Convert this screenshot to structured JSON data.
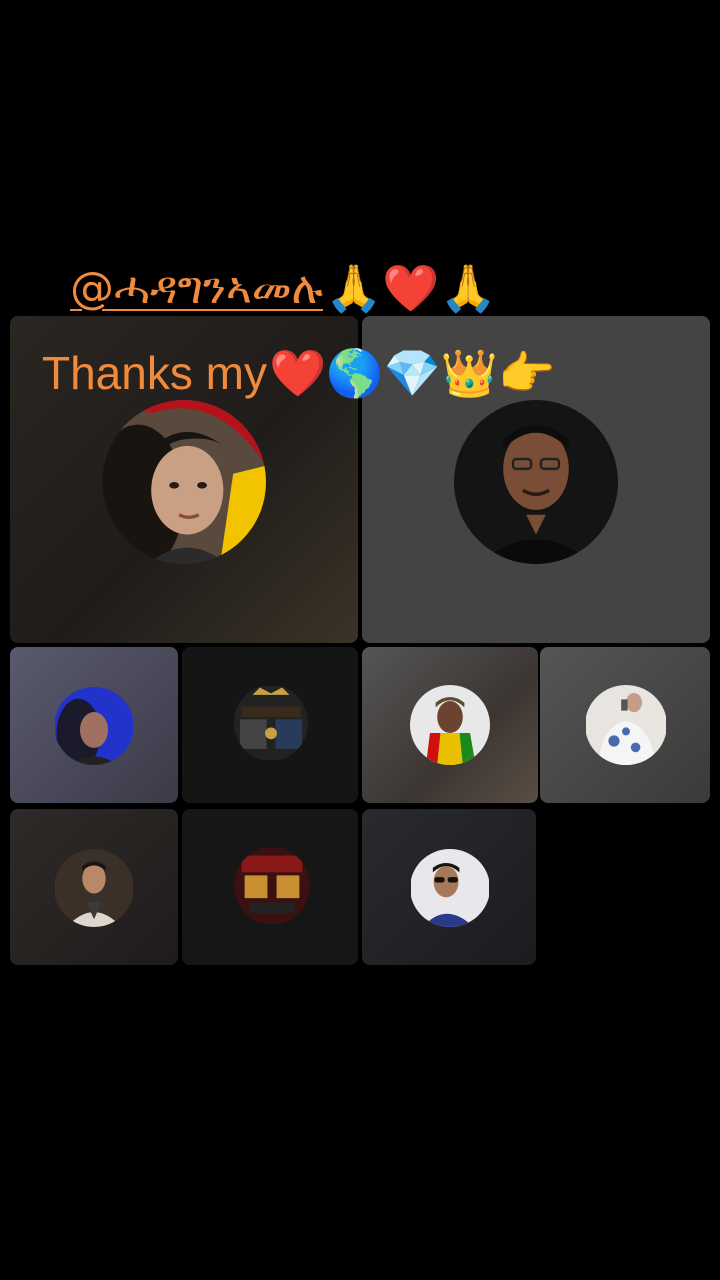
{
  "overlay": {
    "mention": "@ሓዳግንኣመሉ",
    "mention_emojis": "🙏❤️🙏",
    "thanks_text": "Thanks my",
    "thanks_emojis": "❤️🌎💎👑👉"
  },
  "grid": {
    "participants": [
      {
        "id": "p1",
        "icon": "avatar-woman-curly-hair"
      },
      {
        "id": "p2",
        "icon": "avatar-man-glasses"
      },
      {
        "id": "p3",
        "icon": "avatar-woman-blue-light"
      },
      {
        "id": "p4",
        "icon": "avatar-event-poster-vs"
      },
      {
        "id": "p5",
        "icon": "avatar-man-cap-flag"
      },
      {
        "id": "p6",
        "icon": "avatar-woman-selfie"
      },
      {
        "id": "p7",
        "icon": "avatar-man-suit"
      },
      {
        "id": "p8",
        "icon": "avatar-event-poster-red"
      },
      {
        "id": "p9",
        "icon": "avatar-man-sunglasses"
      }
    ]
  }
}
